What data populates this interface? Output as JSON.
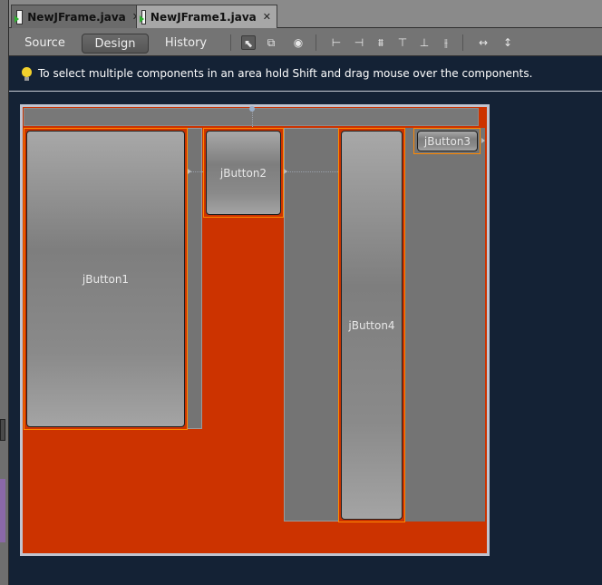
{
  "tabs": [
    {
      "label": "NewJFrame.java",
      "icon": "java-file-icon",
      "active": false
    },
    {
      "label": "NewJFrame1.java",
      "icon": "java-file-icon",
      "active": true
    }
  ],
  "toolbar": {
    "views": [
      "Source",
      "Design",
      "History"
    ],
    "active_view": "Design",
    "tools": [
      "selection-mode-icon",
      "connection-mode-icon",
      "preview-design-icon",
      "align-left-icon",
      "align-right-icon",
      "center-horizontally-icon",
      "align-top-icon",
      "align-bottom-icon",
      "center-vertically-icon",
      "change-horizontal-resizability-icon",
      "change-vertical-resizability-icon"
    ]
  },
  "hint": {
    "icon": "lightbulb-icon",
    "text": "To select multiple components in an area hold Shift and drag mouse over the components."
  },
  "form": {
    "buttons": [
      {
        "label": "jButton1"
      },
      {
        "label": "jButton2"
      },
      {
        "label": "jButton3"
      },
      {
        "label": "jButton4"
      }
    ]
  },
  "colors": {
    "canvas_bg": "#142235",
    "frame_fill": "#cc3300",
    "selection_border": "#ff8800",
    "panel_gray": "#747474"
  }
}
